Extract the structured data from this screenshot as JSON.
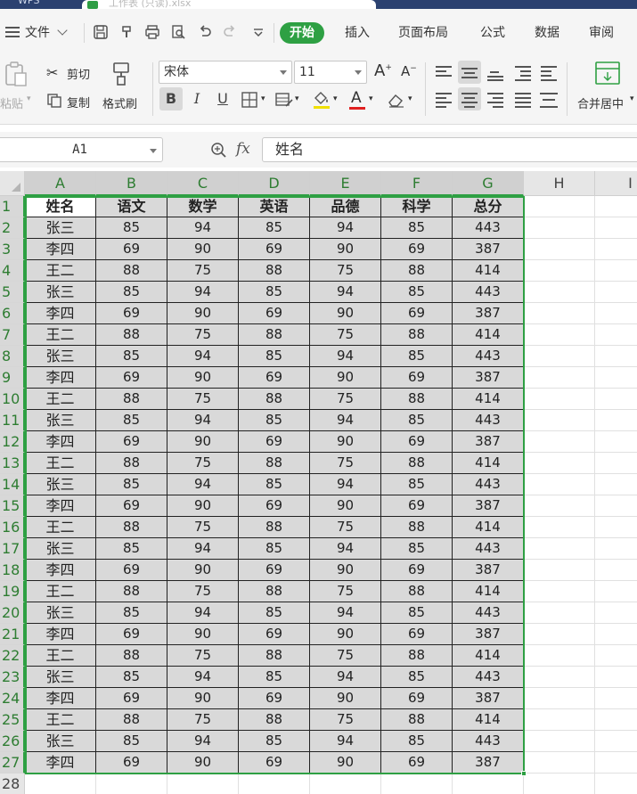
{
  "window": {
    "tab1": "WPS",
    "tab2": "工作表 (只读).xlsx"
  },
  "menu": {
    "file_label": "文件",
    "tabs": [
      "开始",
      "插入",
      "页面布局",
      "公式",
      "数据",
      "审阅"
    ],
    "active_tab": "开始"
  },
  "ribbon": {
    "paste": "粘贴",
    "cut": "剪切",
    "copy": "复制",
    "format_painter": "格式刷",
    "font_name": "宋体",
    "font_size": "11",
    "bold": "B",
    "italic": "I",
    "underline": "U",
    "font_color_letter": "A",
    "font_color": "#e02020",
    "fill_color": "#f0e000",
    "merge_center": "合并居中"
  },
  "formula_bar": {
    "cell_ref": "A1",
    "fx": "fx",
    "value": "姓名"
  },
  "sheet": {
    "columns": [
      "A",
      "B",
      "C",
      "D",
      "E",
      "F",
      "G",
      "H",
      "I"
    ],
    "headers": [
      "姓名",
      "语文",
      "数学",
      "英语",
      "品德",
      "科学",
      "总分"
    ],
    "rows": [
      [
        "张三",
        "85",
        "94",
        "85",
        "94",
        "85",
        "443"
      ],
      [
        "李四",
        "69",
        "90",
        "69",
        "90",
        "69",
        "387"
      ],
      [
        "王二",
        "88",
        "75",
        "88",
        "75",
        "88",
        "414"
      ],
      [
        "张三",
        "85",
        "94",
        "85",
        "94",
        "85",
        "443"
      ],
      [
        "李四",
        "69",
        "90",
        "69",
        "90",
        "69",
        "387"
      ],
      [
        "王二",
        "88",
        "75",
        "88",
        "75",
        "88",
        "414"
      ],
      [
        "张三",
        "85",
        "94",
        "85",
        "94",
        "85",
        "443"
      ],
      [
        "李四",
        "69",
        "90",
        "69",
        "90",
        "69",
        "387"
      ],
      [
        "王二",
        "88",
        "75",
        "88",
        "75",
        "88",
        "414"
      ],
      [
        "张三",
        "85",
        "94",
        "85",
        "94",
        "85",
        "443"
      ],
      [
        "李四",
        "69",
        "90",
        "69",
        "90",
        "69",
        "387"
      ],
      [
        "王二",
        "88",
        "75",
        "88",
        "75",
        "88",
        "414"
      ],
      [
        "张三",
        "85",
        "94",
        "85",
        "94",
        "85",
        "443"
      ],
      [
        "李四",
        "69",
        "90",
        "69",
        "90",
        "69",
        "387"
      ],
      [
        "王二",
        "88",
        "75",
        "88",
        "75",
        "88",
        "414"
      ],
      [
        "张三",
        "85",
        "94",
        "85",
        "94",
        "85",
        "443"
      ],
      [
        "李四",
        "69",
        "90",
        "69",
        "90",
        "69",
        "387"
      ],
      [
        "王二",
        "88",
        "75",
        "88",
        "75",
        "88",
        "414"
      ],
      [
        "张三",
        "85",
        "94",
        "85",
        "94",
        "85",
        "443"
      ],
      [
        "李四",
        "69",
        "90",
        "69",
        "90",
        "69",
        "387"
      ],
      [
        "王二",
        "88",
        "75",
        "88",
        "75",
        "88",
        "414"
      ],
      [
        "张三",
        "85",
        "94",
        "85",
        "94",
        "85",
        "443"
      ],
      [
        "李四",
        "69",
        "90",
        "69",
        "90",
        "69",
        "387"
      ],
      [
        "王二",
        "88",
        "75",
        "88",
        "75",
        "88",
        "414"
      ],
      [
        "张三",
        "85",
        "94",
        "85",
        "94",
        "85",
        "443"
      ],
      [
        "李四",
        "69",
        "90",
        "69",
        "90",
        "69",
        "387"
      ]
    ],
    "row_numbers": [
      "1",
      "2",
      "3",
      "4",
      "5",
      "6",
      "7",
      "8",
      "9",
      "10",
      "11",
      "12",
      "13",
      "14",
      "15",
      "16",
      "17",
      "18",
      "19",
      "20",
      "21",
      "22",
      "23",
      "24",
      "25",
      "26",
      "27",
      "28"
    ],
    "accent": "#2ea043"
  }
}
